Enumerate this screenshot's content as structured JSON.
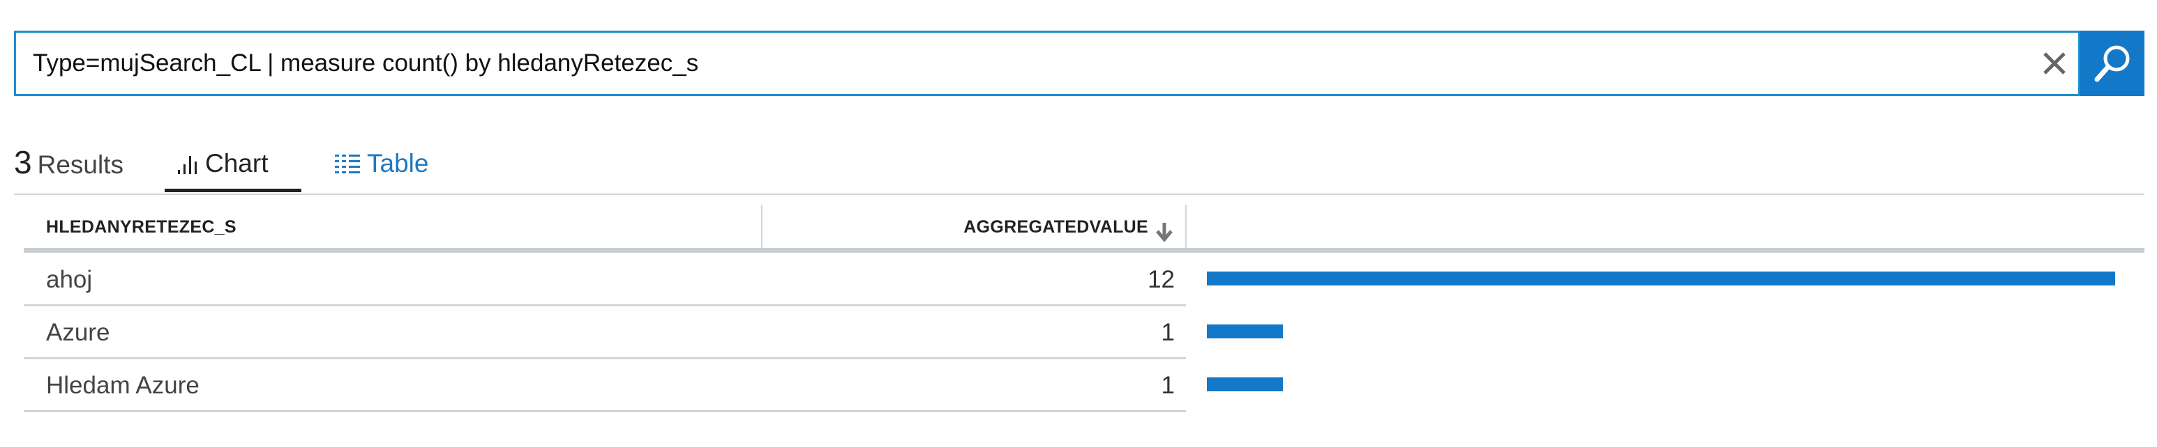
{
  "search": {
    "query": "Type=mujSearch_CL | measure count() by hledanyRetezec_s",
    "accent_color": "#1e8fd0",
    "button_color": "#1478c8",
    "clear_icon": "close-icon",
    "search_icon": "search-icon"
  },
  "results": {
    "count": "3",
    "label": "Results"
  },
  "tabs": [
    {
      "label": "Chart",
      "icon": "bar-chart-icon",
      "selected": true
    },
    {
      "label": "Table",
      "icon": "table-icon",
      "selected": false
    }
  ],
  "table": {
    "columns": [
      "HLEDANYRETEZEC_S",
      "AGGREGATEDVALUE"
    ],
    "sort_icon": "sort-descending-icon",
    "bar_color": "#1478c8",
    "rows": [
      {
        "name": "ahoj",
        "value": "12"
      },
      {
        "name": "Azure",
        "value": "1"
      },
      {
        "name": "Hledam Azure",
        "value": "1"
      }
    ]
  }
}
